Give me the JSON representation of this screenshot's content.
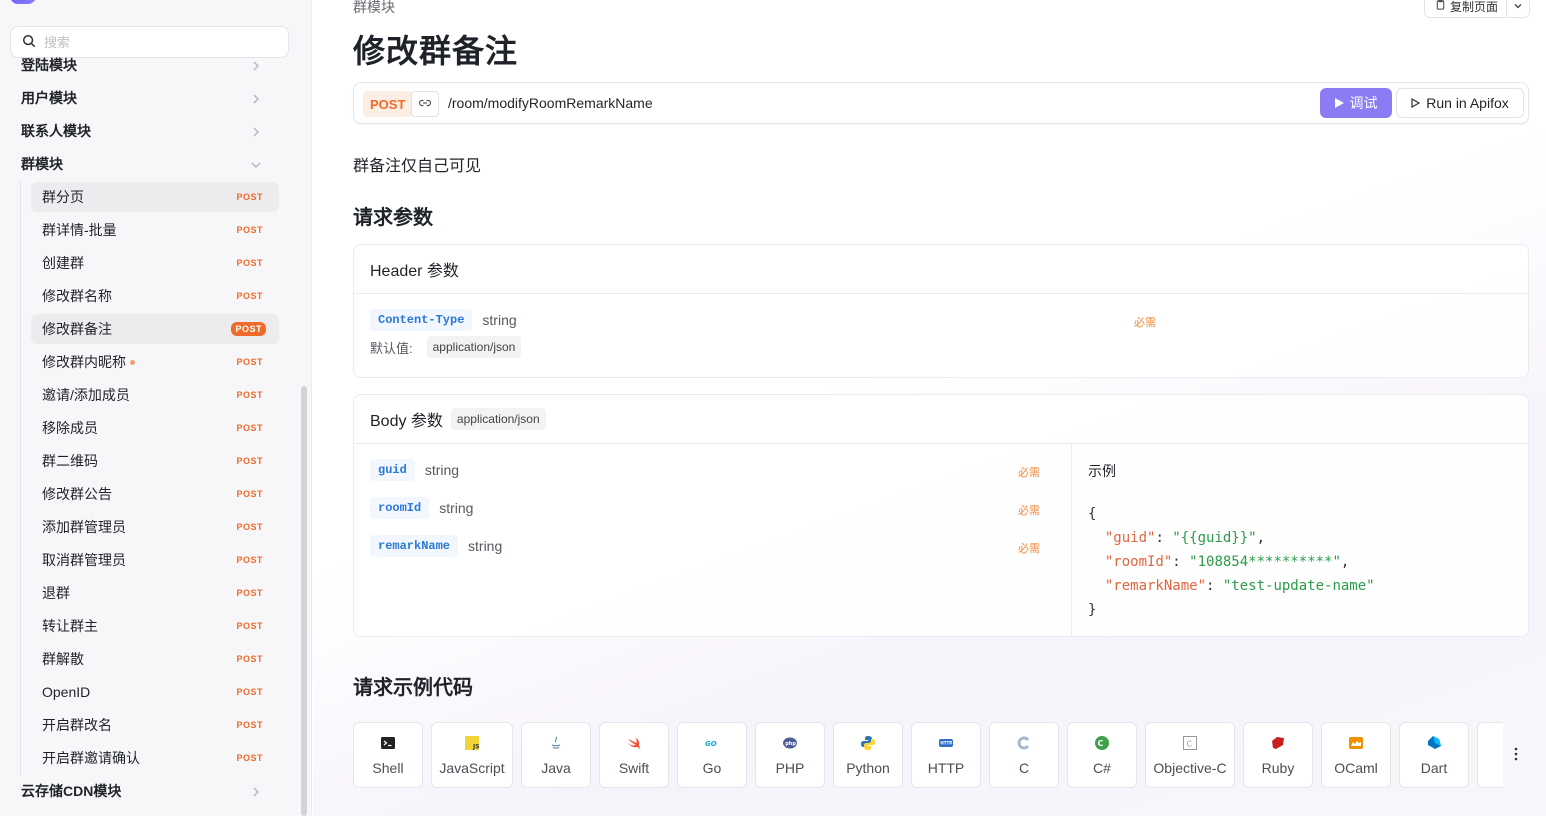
{
  "sidebar": {
    "search_placeholder": "搜索",
    "groups": [
      {
        "label": "登陆模块"
      },
      {
        "label": "用户模块"
      },
      {
        "label": "联系人模块"
      },
      {
        "label": "群模块"
      },
      {
        "label": "云存储CDN模块"
      }
    ],
    "items": [
      {
        "label": "群分页",
        "tag": "POST"
      },
      {
        "label": "群详情-批量",
        "tag": "POST"
      },
      {
        "label": "创建群",
        "tag": "POST"
      },
      {
        "label": "修改群名称",
        "tag": "POST"
      },
      {
        "label": "修改群备注",
        "tag": "POST"
      },
      {
        "label": "修改群内昵称",
        "tag": "POST"
      },
      {
        "label": "邀请/添加成员",
        "tag": "POST"
      },
      {
        "label": "移除成员",
        "tag": "POST"
      },
      {
        "label": "群二维码",
        "tag": "POST"
      },
      {
        "label": "修改群公告",
        "tag": "POST"
      },
      {
        "label": "添加群管理员",
        "tag": "POST"
      },
      {
        "label": "取消群管理员",
        "tag": "POST"
      },
      {
        "label": "退群",
        "tag": "POST"
      },
      {
        "label": "转让群主",
        "tag": "POST"
      },
      {
        "label": "群解散",
        "tag": "POST"
      },
      {
        "label": "OpenID",
        "tag": "POST"
      },
      {
        "label": "开启群改名",
        "tag": "POST"
      },
      {
        "label": "开启群邀请确认",
        "tag": "POST"
      }
    ]
  },
  "header": {
    "breadcrumb": "群模块",
    "title": "修改群备注",
    "copy_page": "复制页面"
  },
  "endpoint": {
    "method": "POST",
    "path": "/room/modifyRoomRemarkName",
    "debug_label": "调试",
    "apifox_label": "Run in Apifox"
  },
  "description": "群备注仅自己可见",
  "request_params": {
    "title": "请求参数",
    "header": {
      "title": "Header 参数",
      "name": "Content-Type",
      "type": "string",
      "required": "必需",
      "default_label": "默认值:",
      "default_value": "application/json"
    },
    "body": {
      "title": "Body 参数",
      "content_type": "application/json",
      "params": [
        {
          "name": "guid",
          "type": "string",
          "required": "必需"
        },
        {
          "name": "roomId",
          "type": "string",
          "required": "必需"
        },
        {
          "name": "remarkName",
          "type": "string",
          "required": "必需"
        }
      ],
      "example_title": "示例",
      "example": {
        "open": "{",
        "close": "}",
        "lines": [
          {
            "key": "\"guid\"",
            "value": "\"{{guid}}\"",
            "sep": ","
          },
          {
            "key": "\"roomId\"",
            "value": "\"108854**********\"",
            "sep": ","
          },
          {
            "key": "\"remarkName\"",
            "value": "\"test-update-name\"",
            "sep": ""
          }
        ]
      }
    }
  },
  "code_samples": {
    "title": "请求示例代码",
    "languages": [
      {
        "label": "Shell",
        "icon": "terminal-icon"
      },
      {
        "label": "JavaScript",
        "icon": "javascript-icon"
      },
      {
        "label": "Java",
        "icon": "java-icon"
      },
      {
        "label": "Swift",
        "icon": "swift-icon"
      },
      {
        "label": "Go",
        "icon": "go-icon"
      },
      {
        "label": "PHP",
        "icon": "php-icon"
      },
      {
        "label": "Python",
        "icon": "python-icon"
      },
      {
        "label": "HTTP",
        "icon": "http-icon"
      },
      {
        "label": "C",
        "icon": "c-icon"
      },
      {
        "label": "C#",
        "icon": "csharp-icon"
      },
      {
        "label": "Objective-C",
        "icon": "objective-c-icon"
      },
      {
        "label": "Ruby",
        "icon": "ruby-icon"
      },
      {
        "label": "OCaml",
        "icon": "ocaml-icon"
      },
      {
        "label": "Dart",
        "icon": "dart-icon"
      }
    ]
  },
  "colors": {
    "accent": "#8b7cf6",
    "post": "#f06a2a",
    "param_name": "#2b78d8",
    "required": "#f08a3a",
    "json_key": "#e0663f",
    "json_value": "#2c9c4a"
  }
}
